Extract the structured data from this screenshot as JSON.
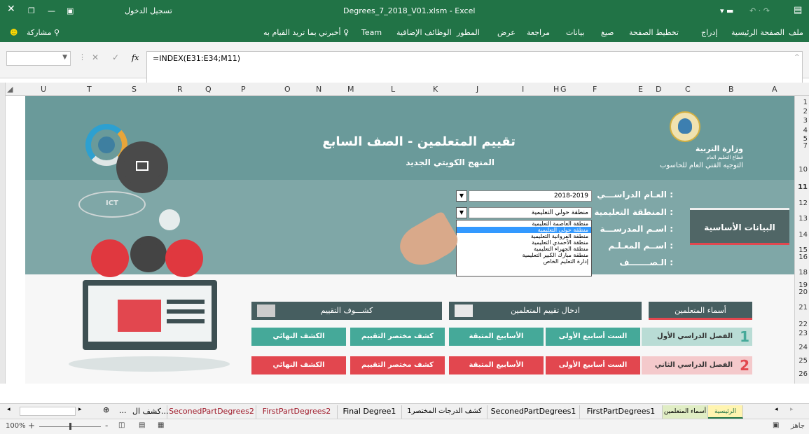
{
  "titlebar": {
    "filename": "Degrees_7_2018_V01.xlsm  -  Excel",
    "sign_in": "تسجيل الدخول"
  },
  "ribbon": {
    "tabs": [
      "ملف",
      "الصفحة الرئيسية",
      "إدراج",
      "تخطيط الصفحة",
      "صيغ",
      "بيانات",
      "مراجعة",
      "عرض",
      "المطور",
      "الوظائف الإضافية",
      "Team"
    ],
    "tell_me": "أخبرني بما تريد القيام به",
    "share": "مشاركة"
  },
  "formula_bar": {
    "formula": "=INDEX(E31:E34;M11)",
    "fx": "fx"
  },
  "columns": [
    "U",
    "T",
    "S",
    "R",
    "Q",
    "P",
    "O",
    "N",
    "M",
    "L",
    "K",
    "J",
    "I",
    "H",
    "G",
    "F",
    "E",
    "D",
    "C",
    "B",
    "A"
  ],
  "rows": [
    "1",
    "2",
    "3",
    "4",
    "5",
    "7",
    "10",
    "11",
    "12",
    "13",
    "14",
    "15",
    "16",
    "18",
    "19",
    "20",
    "21",
    "22",
    "23",
    "24",
    "25",
    "26"
  ],
  "header": {
    "title": "تقييم المتعلمين - الصف السابع",
    "subtitle": "المنهج الكويتي الجديد",
    "ministry_1": "وزارة التربية",
    "ministry_2": "قطاع التعليم العام",
    "ministry_3": "التوجيه الفني العام للحاسوب",
    "ict": "ICT"
  },
  "form": {
    "labels": [
      "العـام الدراســـي :",
      "المنطقة التعليمية :",
      "اسـم المدرســـة :",
      "اســم المعـلـم :",
      "الـصـــــــف :"
    ],
    "year": "2018-2019",
    "region": "منطقة حولي التعليمية",
    "options": [
      "منطقة العاصمة التعليمية",
      "منطقة حولي التعليمية",
      "منطقة الفروانية التعليمية",
      "منطقة الأحمدي التعليمية",
      "منطقة الجهراء التعليمية",
      "منطقة مبارك الكبير التعليمية",
      "إدارة التعليم الخاص"
    ],
    "basic_data": "البيانات الأساسية"
  },
  "sections": {
    "students": "أسماء المتعلمين",
    "enter_eval": "ادخال تقييم المتعلمين",
    "reports": "كشـــوف التقييم"
  },
  "sem1": {
    "label": "الفصل الدراسي الأول",
    "num": "1",
    "buttons": [
      "الست أسابيع الأولى",
      "الأسابيع المتبقة",
      "كشف مختصر التقييم",
      "الكشف النهائي"
    ]
  },
  "sem2": {
    "label": "الفصل الدراسي الثاني",
    "num": "2",
    "buttons": [
      "الست أسابيع الأولى",
      "الأسابيع المتبقة",
      "كشف مختصر التقييم",
      "الكشف النهائي"
    ]
  },
  "sheet_tabs": [
    "الرئيسية",
    "أسماء المتعلمين",
    "FirstPartDegrees1",
    "SeconedPartDegrees1",
    "كشف الدرجات المختصر1",
    "Final Degree1",
    "FirstPartDegrees2",
    "SeconedPartDegrees2",
    "كشف ال..."
  ],
  "status": {
    "ready": "جاهز",
    "zoom": "100%"
  },
  "colors": {
    "excel_green": "#217346",
    "teal": "#45a999",
    "red": "#e2474f",
    "banner": "#6a9a9a"
  }
}
